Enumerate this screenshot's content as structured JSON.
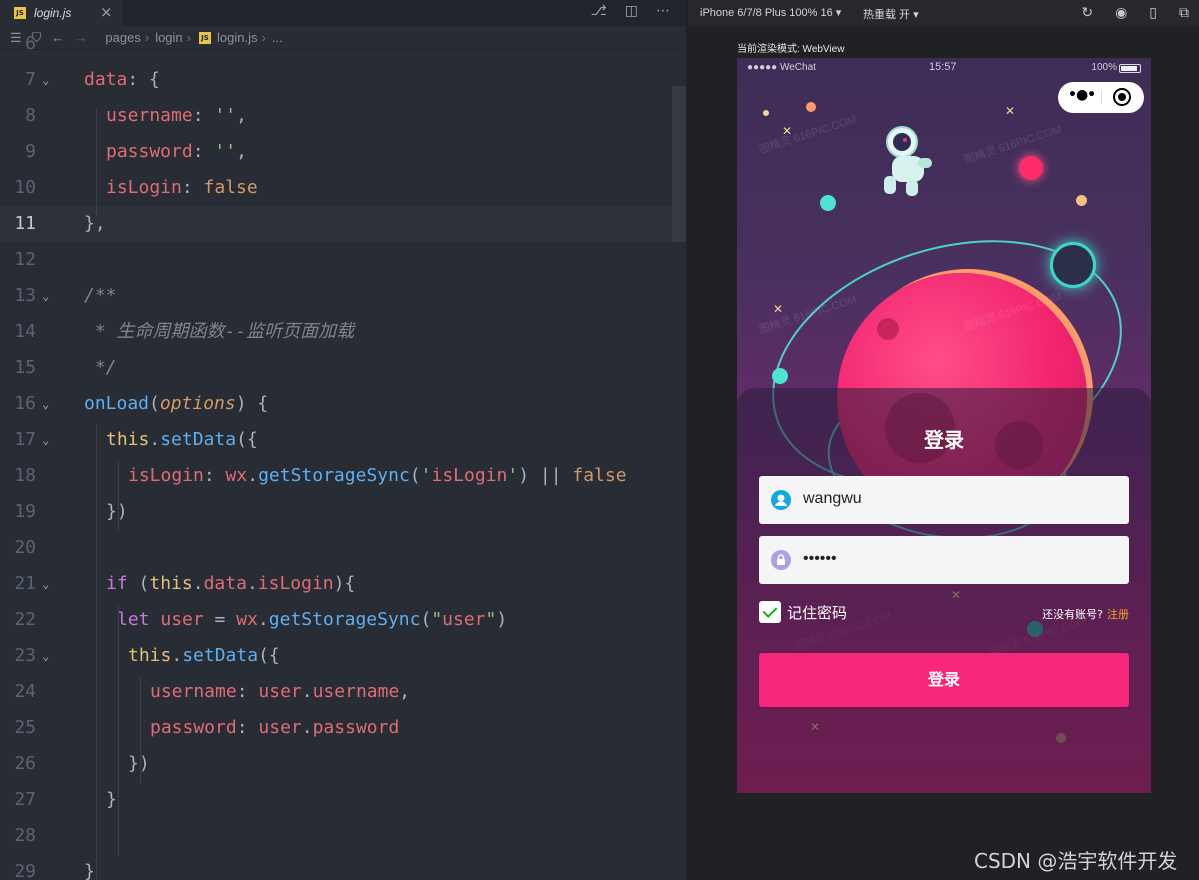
{
  "editor": {
    "tab": {
      "label": "login.js",
      "close": "×",
      "icon": "js-file-icon"
    },
    "breadcrumb": [
      "pages",
      "login",
      "login.js",
      "..."
    ],
    "lines": [
      {
        "n": "6",
        "t": ""
      },
      {
        "n": "7",
        "t": "data: {"
      },
      {
        "n": "8",
        "t": "username: '',"
      },
      {
        "n": "9",
        "t": "password: '',"
      },
      {
        "n": "10",
        "t": "isLogin: false"
      },
      {
        "n": "11",
        "t": "},"
      },
      {
        "n": "12",
        "t": ""
      },
      {
        "n": "13",
        "t": "/**"
      },
      {
        "n": "14",
        "t": " * 生命周期函数--监听页面加载"
      },
      {
        "n": "15",
        "t": " */"
      },
      {
        "n": "16",
        "t": "onLoad(options) {"
      },
      {
        "n": "17",
        "t": "this.setData({"
      },
      {
        "n": "18",
        "t": "isLogin: wx.getStorageSync('isLogin') || false"
      },
      {
        "n": "19",
        "t": "})"
      },
      {
        "n": "20",
        "t": ""
      },
      {
        "n": "21",
        "t": "if (this.data.isLogin){"
      },
      {
        "n": "22",
        "t": "let user = wx.getStorageSync(\"user\")"
      },
      {
        "n": "23",
        "t": "this.setData({"
      },
      {
        "n": "24",
        "t": "username: user.username,"
      },
      {
        "n": "25",
        "t": "password: user.password"
      },
      {
        "n": "26",
        "t": "})"
      },
      {
        "n": "27",
        "t": "}"
      },
      {
        "n": "28",
        "t": ""
      },
      {
        "n": "29",
        "t": "}"
      }
    ]
  },
  "simulator": {
    "device": "iPhone 6/7/8 Plus 100% 16 ▾",
    "hot_reload": "热重载 开 ▾",
    "render_mode": "当前渲染模式: WebView",
    "status": {
      "signal": "●●●●● WeChat",
      "time": "15:57",
      "battery": "100%"
    },
    "watermark": "图精灵 616PIC.COM",
    "login": {
      "title": "登录",
      "username_value": "wangwu",
      "password_value": "••••••",
      "remember_label": "记住密码",
      "no_account": "还没有账号?",
      "register": "注册",
      "button": "登录"
    }
  },
  "watermark_footer": "CSDN @浩宇软件开发",
  "colors": {
    "accent": "#f6267a",
    "editor_bg": "#282c34",
    "register": "#f5a623"
  }
}
